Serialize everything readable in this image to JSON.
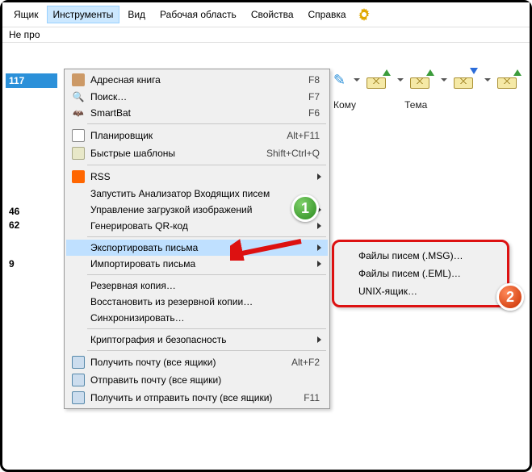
{
  "menubar": {
    "items": [
      "Ящик",
      "Инструменты",
      "Вид",
      "Рабочая область",
      "Свойства",
      "Справка"
    ],
    "active_index": 1
  },
  "subbar": {
    "label": "Не про"
  },
  "left_numbers": {
    "top_bold": "117",
    "n1": "46",
    "n2": "62",
    "n3": "9"
  },
  "table_headers": {
    "col1": "Кому",
    "col2": "Тема"
  },
  "dropdown": {
    "items": [
      {
        "icon": "book-icon",
        "label": "Адресная книга",
        "shortcut": "F8"
      },
      {
        "icon": "search-icon",
        "label": "Поиск…",
        "shortcut": "F7"
      },
      {
        "icon": "bat-icon",
        "label": "SmartBat",
        "shortcut": "F6"
      },
      {
        "sep": true
      },
      {
        "icon": "calendar-icon",
        "label": "Планировщик",
        "shortcut": "Alt+F11"
      },
      {
        "icon": "template-icon",
        "label": "Быстрые шаблоны",
        "shortcut": "Shift+Ctrl+Q"
      },
      {
        "sep": true
      },
      {
        "icon": "rss-icon",
        "label": "RSS",
        "submenu": true
      },
      {
        "label": "Запустить Анализатор Входящих писем"
      },
      {
        "label": "Управление загрузкой изображений",
        "submenu": true
      },
      {
        "label": "Генерировать QR-код",
        "submenu": true
      },
      {
        "sep": true
      },
      {
        "label": "Экспортировать письма",
        "submenu": true,
        "highlight": true
      },
      {
        "label": "Импортировать письма",
        "submenu": true
      },
      {
        "sep": true
      },
      {
        "label": "Резервная копия…"
      },
      {
        "label": "Восстановить из резервной копии…"
      },
      {
        "label": "Синхронизировать…"
      },
      {
        "sep": true
      },
      {
        "label": "Криптография и безопасность",
        "submenu": true
      },
      {
        "sep": true
      },
      {
        "icon": "mail-in-icon",
        "label": "Получить почту (все ящики)",
        "shortcut": "Alt+F2"
      },
      {
        "icon": "mail-out-icon",
        "label": "Отправить почту (все ящики)"
      },
      {
        "icon": "mail-sync-icon",
        "label": "Получить и отправить почту (все ящики)",
        "shortcut": "F11"
      }
    ]
  },
  "submenu": {
    "items": [
      "Файлы писем (.MSG)…",
      "Файлы писем (.EML)…",
      "UNIX-ящик…"
    ]
  },
  "badges": {
    "b1": "1",
    "b2": "2"
  }
}
